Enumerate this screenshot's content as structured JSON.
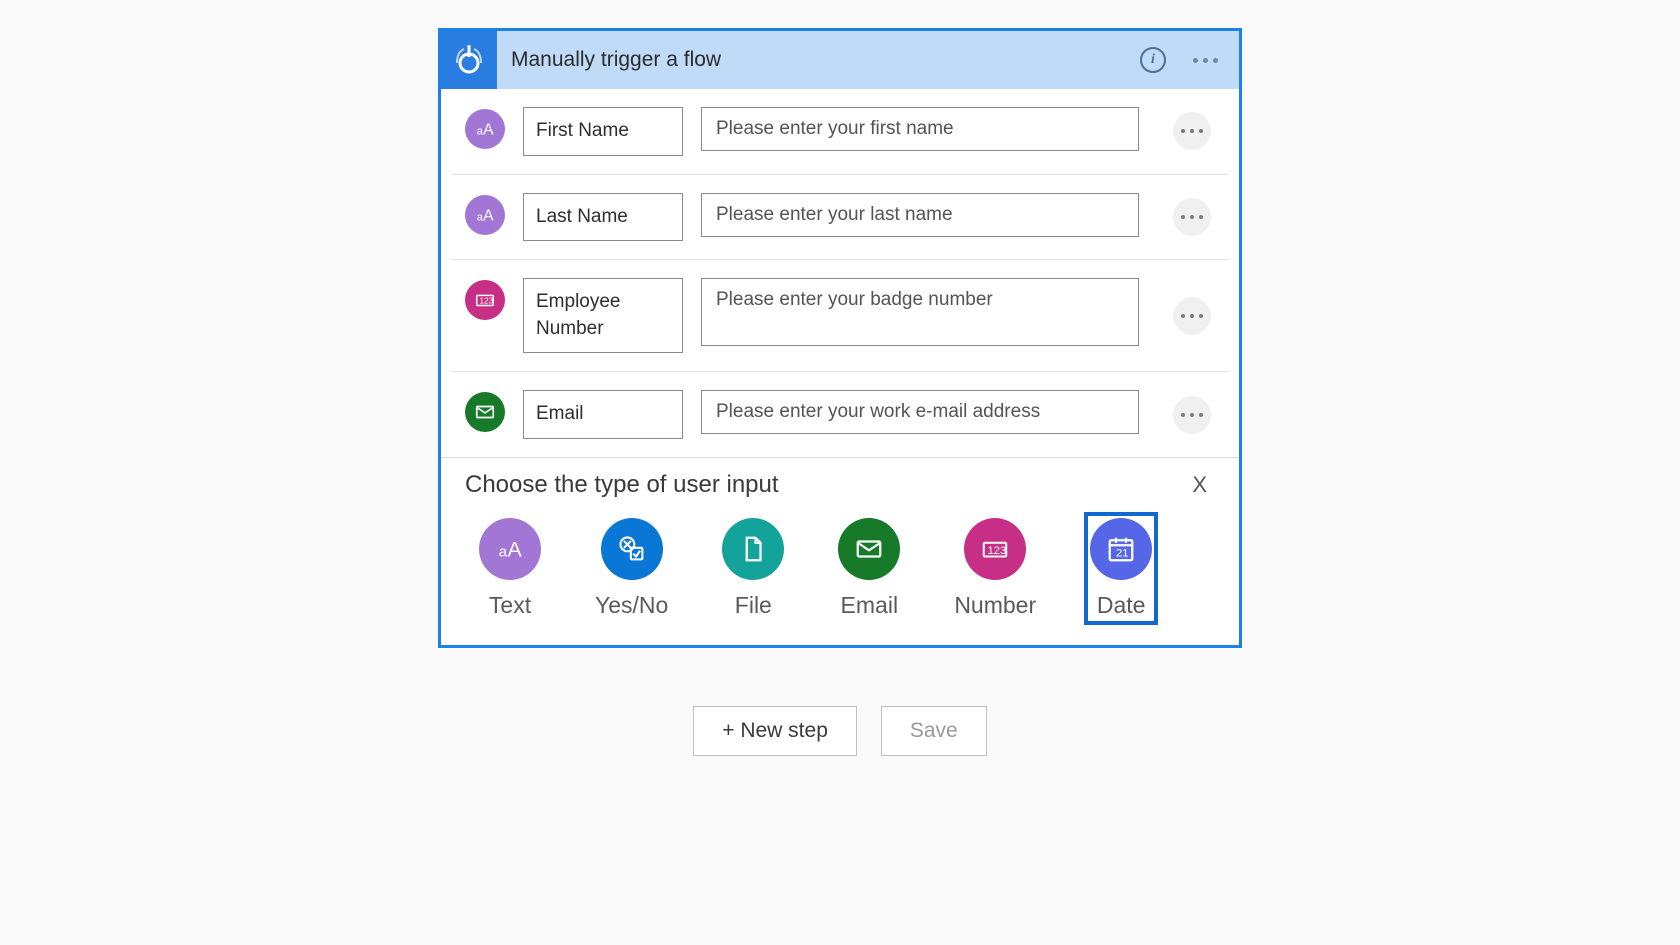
{
  "trigger": {
    "title": "Manually trigger a flow",
    "inputs": [
      {
        "name": "First Name",
        "placeholder": "Please enter your first name",
        "iconType": "text"
      },
      {
        "name": "Last Name",
        "placeholder": "Please enter your last name",
        "iconType": "text"
      },
      {
        "name": "Employee Number",
        "placeholder": "Please enter your badge number",
        "iconType": "number"
      },
      {
        "name": "Email",
        "placeholder": "Please enter your work e-mail address",
        "iconType": "email"
      }
    ]
  },
  "choosePanel": {
    "title": "Choose the type of user input",
    "closeLabel": "X",
    "options": [
      {
        "label": "Text",
        "type": "text",
        "selected": false
      },
      {
        "label": "Yes/No",
        "type": "yesno",
        "selected": false
      },
      {
        "label": "File",
        "type": "file",
        "selected": false
      },
      {
        "label": "Email",
        "type": "email",
        "selected": false
      },
      {
        "label": "Number",
        "type": "number",
        "selected": false
      },
      {
        "label": "Date",
        "type": "date",
        "selected": true
      }
    ]
  },
  "footer": {
    "newStep": "+ New step",
    "save": "Save"
  }
}
